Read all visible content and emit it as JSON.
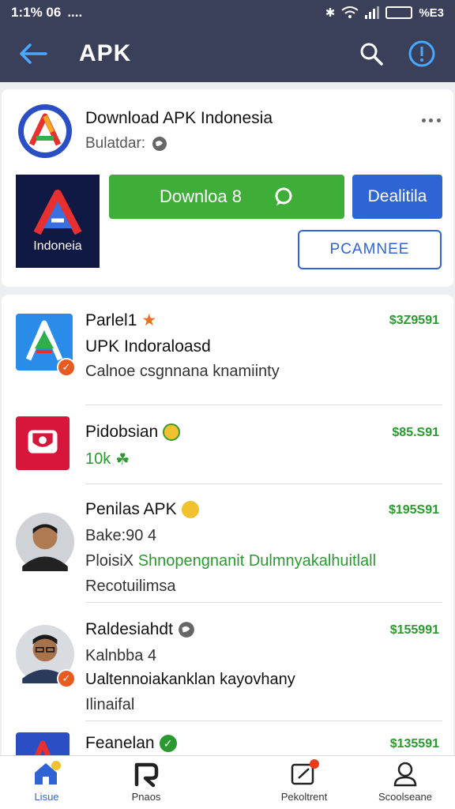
{
  "status_bar": {
    "time": "1:1% 06",
    "dots": "....",
    "battery_label": "%E3"
  },
  "app_bar": {
    "title": "APK"
  },
  "featured": {
    "title": "Download APK Indonesia",
    "subtitle": "Bulatdar:",
    "banner_label": "Indoneia",
    "download_label": "Downloa 8",
    "detail_label": "Dealitila",
    "outline_label": "PCAMNEE"
  },
  "list": [
    {
      "line1": "Parlel1",
      "line2": "UPK Indoraloasd",
      "line3": "Calnoe csgnnana knamiinty",
      "price": "$3Z9591"
    },
    {
      "line1": "Pidobsian",
      "line2": "10k",
      "price": "$85.S91"
    },
    {
      "line1": "Penilas APK",
      "line2": "Bake:90 4",
      "line3a": "PloisiX",
      "line3b": "Shnopengnanit Dulmnyakalhuitlall",
      "line4": "Recotuilimsa",
      "price": "$195S91"
    },
    {
      "line1": "Raldesiahdt",
      "line2": "Kalnbba 4",
      "line3": "Ualtennoiakanklan kayovhany",
      "line4": "Ilinaifal",
      "price": "$155991"
    },
    {
      "line1": "Feanelan",
      "price": "$135591"
    }
  ],
  "bottom_nav": [
    {
      "label": "Lisue"
    },
    {
      "label": "Pnaos"
    },
    {
      "label": "Pekoltrent"
    },
    {
      "label": "Scoolseane"
    }
  ],
  "colors": {
    "appbar": "#3a3f5a",
    "green": "#3eae38",
    "blue": "#2e64d4",
    "price": "#2a9a30"
  }
}
